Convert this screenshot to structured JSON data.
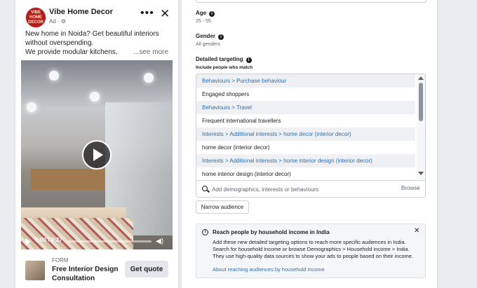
{
  "ad": {
    "page_name": "Vibe Home Decor",
    "avatar_text": "VIBE HOME DECOR",
    "meta": "Ad · ⚙",
    "text_line1": "New home in Noida? Get beautiful interiors",
    "text_line2": "without overspending.",
    "text_line3": "We provide modular kitchens,",
    "see_more": "...see more",
    "video_time": "0:00 / 0:27",
    "cta_type": "FORM",
    "cta_title": "Free Interior Design Consultation",
    "cta_button": "Get quote"
  },
  "panel": {
    "age_label": "Age",
    "age_value": "25 - 55",
    "gender_label": "Gender",
    "gender_value": "All genders",
    "targeting_label": "Detailed targeting",
    "targeting_sub": "Include people who match",
    "targeting_rows": [
      {
        "kind": "category",
        "text": "Behaviours > Purchase behaviour"
      },
      {
        "kind": "item",
        "text": "Engaged shoppers"
      },
      {
        "kind": "category",
        "text": "Behaviours > Travel"
      },
      {
        "kind": "item",
        "text": "Frequent international travellers"
      },
      {
        "kind": "category",
        "text": "Interests > Additional interests > home decor (interior decor)"
      },
      {
        "kind": "item",
        "text": "home decor (interior decor)"
      },
      {
        "kind": "category",
        "text": "Interests > Additional interests > home interior design (interior decor)"
      },
      {
        "kind": "item",
        "text": "home interior design (interior decor)"
      }
    ],
    "search_placeholder": "Add demographics, interests or behaviours",
    "browse_label": "Browse",
    "narrow_button": "Narrow audience",
    "notice_title": "Reach people by household income in India",
    "notice_line1": "Add these new detailed targeting options to reach more specific audiences in India.",
    "notice_line2": "Search for household income or browse Demographics > Household income > India.",
    "notice_line3": "They use high-quality data sources to show your ads to people based on their income.",
    "notice_link": "About reaching audiences by household income"
  },
  "colors": {
    "accent_link": "#2d6fb5",
    "brand_avatar": "#b31b1b"
  },
  "icons": [
    "more-options-icon",
    "close-icon",
    "info-icon",
    "play-icon",
    "volume-icon",
    "search-icon",
    "scroll-up-icon",
    "scroll-down-icon"
  ]
}
